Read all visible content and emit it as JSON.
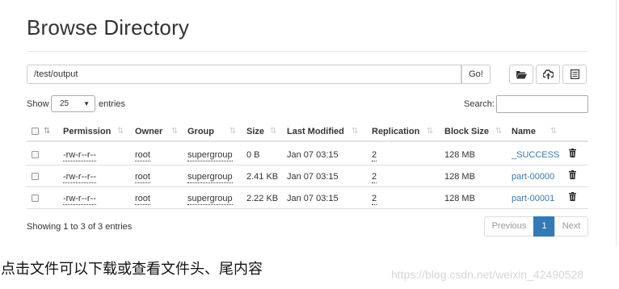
{
  "page": {
    "title": "Browse Directory",
    "path_value": "/test/output",
    "go_label": "Go!",
    "icons": [
      "folder-open-icon",
      "upload-icon",
      "list-icon"
    ]
  },
  "controls": {
    "show_label": "Show",
    "entries_per_page": "25",
    "entries_label": "entries",
    "search_label": "Search:",
    "search_value": ""
  },
  "table": {
    "headers": [
      "Permission",
      "Owner",
      "Group",
      "Size",
      "Last Modified",
      "Replication",
      "Block Size",
      "Name"
    ],
    "rows": [
      {
        "permission": "-rw-r--r--",
        "owner": "root",
        "group": "supergroup",
        "size": "0 B",
        "last_modified": "Jan 07 03:15",
        "replication": "2",
        "block_size": "128 MB",
        "name": "_SUCCESS"
      },
      {
        "permission": "-rw-r--r--",
        "owner": "root",
        "group": "supergroup",
        "size": "2.41 KB",
        "last_modified": "Jan 07 03:15",
        "replication": "2",
        "block_size": "128 MB",
        "name": "part-00000"
      },
      {
        "permission": "-rw-r--r--",
        "owner": "root",
        "group": "supergroup",
        "size": "2.22 KB",
        "last_modified": "Jan 07 03:15",
        "replication": "2",
        "block_size": "128 MB",
        "name": "part-00001"
      }
    ],
    "row_icon": "trash-icon"
  },
  "footer": {
    "info": "Showing 1 to 3 of 3 entries",
    "previous_label": "Previous",
    "current_page": "1",
    "next_label": "Next"
  },
  "caption": "点击文件可以下载或查看文件头、尾内容",
  "watermark": "https://blog.csdn.net/weixin_42490528",
  "colors": {
    "link": "#337ab7",
    "active_page": "#337ab7",
    "muted": "#999999"
  }
}
